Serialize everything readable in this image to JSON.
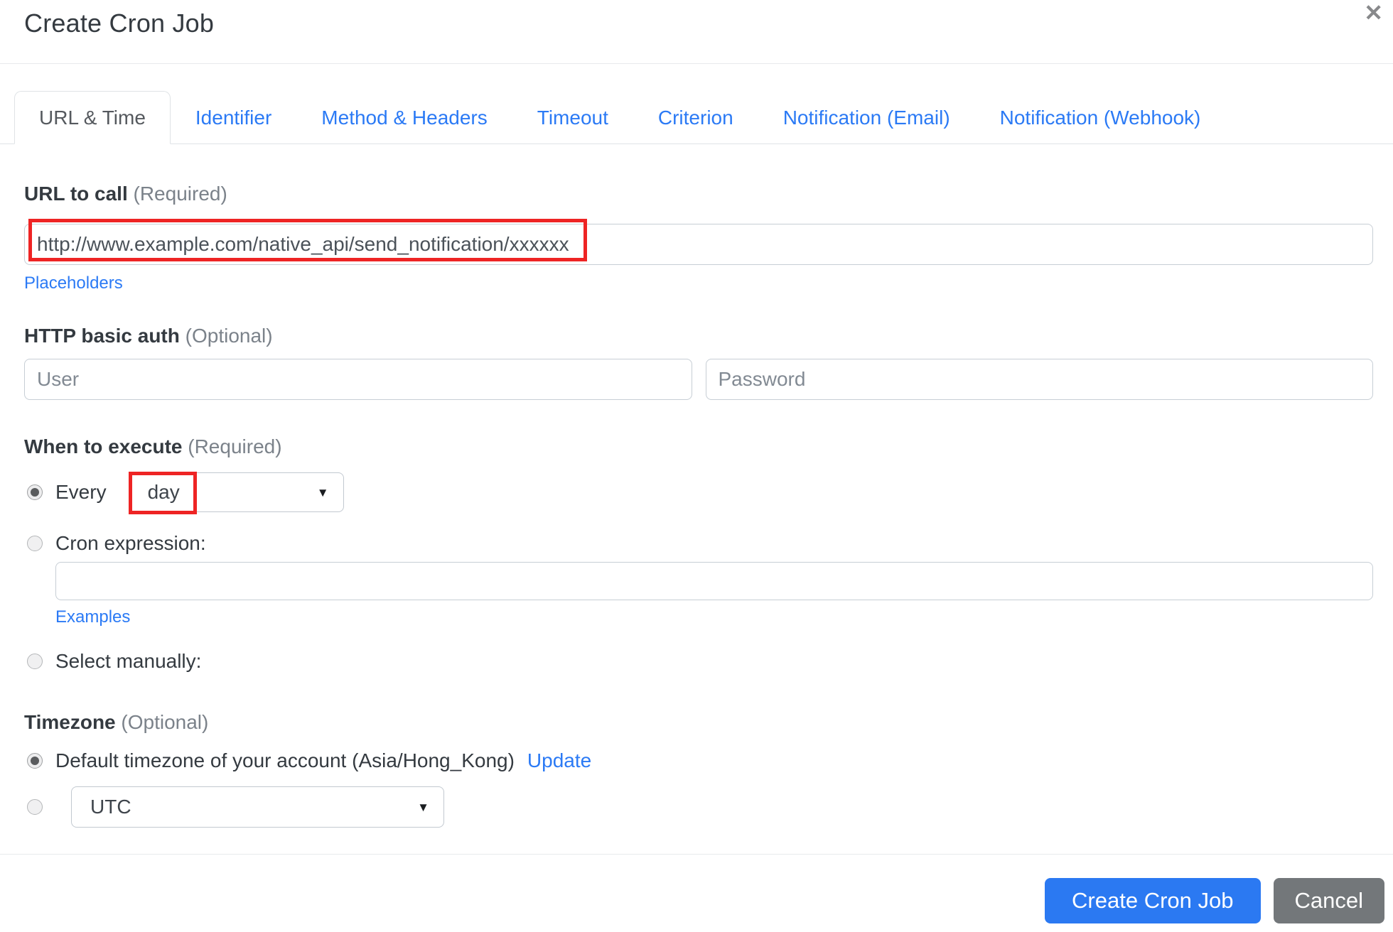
{
  "header": {
    "title": "Create Cron Job",
    "close_glyph": "✕"
  },
  "tabs": {
    "items": [
      {
        "label": "URL & Time",
        "active": true
      },
      {
        "label": "Identifier",
        "active": false
      },
      {
        "label": "Method & Headers",
        "active": false
      },
      {
        "label": "Timeout",
        "active": false
      },
      {
        "label": "Criterion",
        "active": false
      },
      {
        "label": "Notification (Email)",
        "active": false
      },
      {
        "label": "Notification (Webhook)",
        "active": false
      }
    ]
  },
  "url_section": {
    "label": "URL to call",
    "label_suffix": "(Required)",
    "input_value": "http://www.example.com/native_api/send_notification/xxxxxx",
    "placeholders_link": "Placeholders"
  },
  "auth_section": {
    "label": "HTTP basic auth",
    "label_suffix": "(Optional)",
    "user_placeholder": "User",
    "password_placeholder": "Password"
  },
  "schedule_section": {
    "label": "When to execute",
    "label_suffix": "(Required)",
    "every_label": "Every",
    "every_selected_value": "day",
    "cron_label": "Cron expression:",
    "cron_value": "",
    "examples_link": "Examples",
    "manual_label": "Select manually:"
  },
  "timezone_section": {
    "label": "Timezone",
    "label_suffix": "(Optional)",
    "default_label": "Default timezone of your account (Asia/Hong_Kong)",
    "update_link": "Update",
    "selected_timezone": "UTC"
  },
  "footer": {
    "create_label": "Create Cron Job",
    "cancel_label": "Cancel"
  },
  "icons": {
    "dropdown_arrow": "▼",
    "close": "✕"
  },
  "colors": {
    "link_blue": "#2b7af5",
    "primary_button_blue": "#2b79f2",
    "cancel_button_gray": "#73777a",
    "highlight_red": "#ee2424",
    "title_text": "#343a40",
    "input_border": "#c7ced5"
  }
}
